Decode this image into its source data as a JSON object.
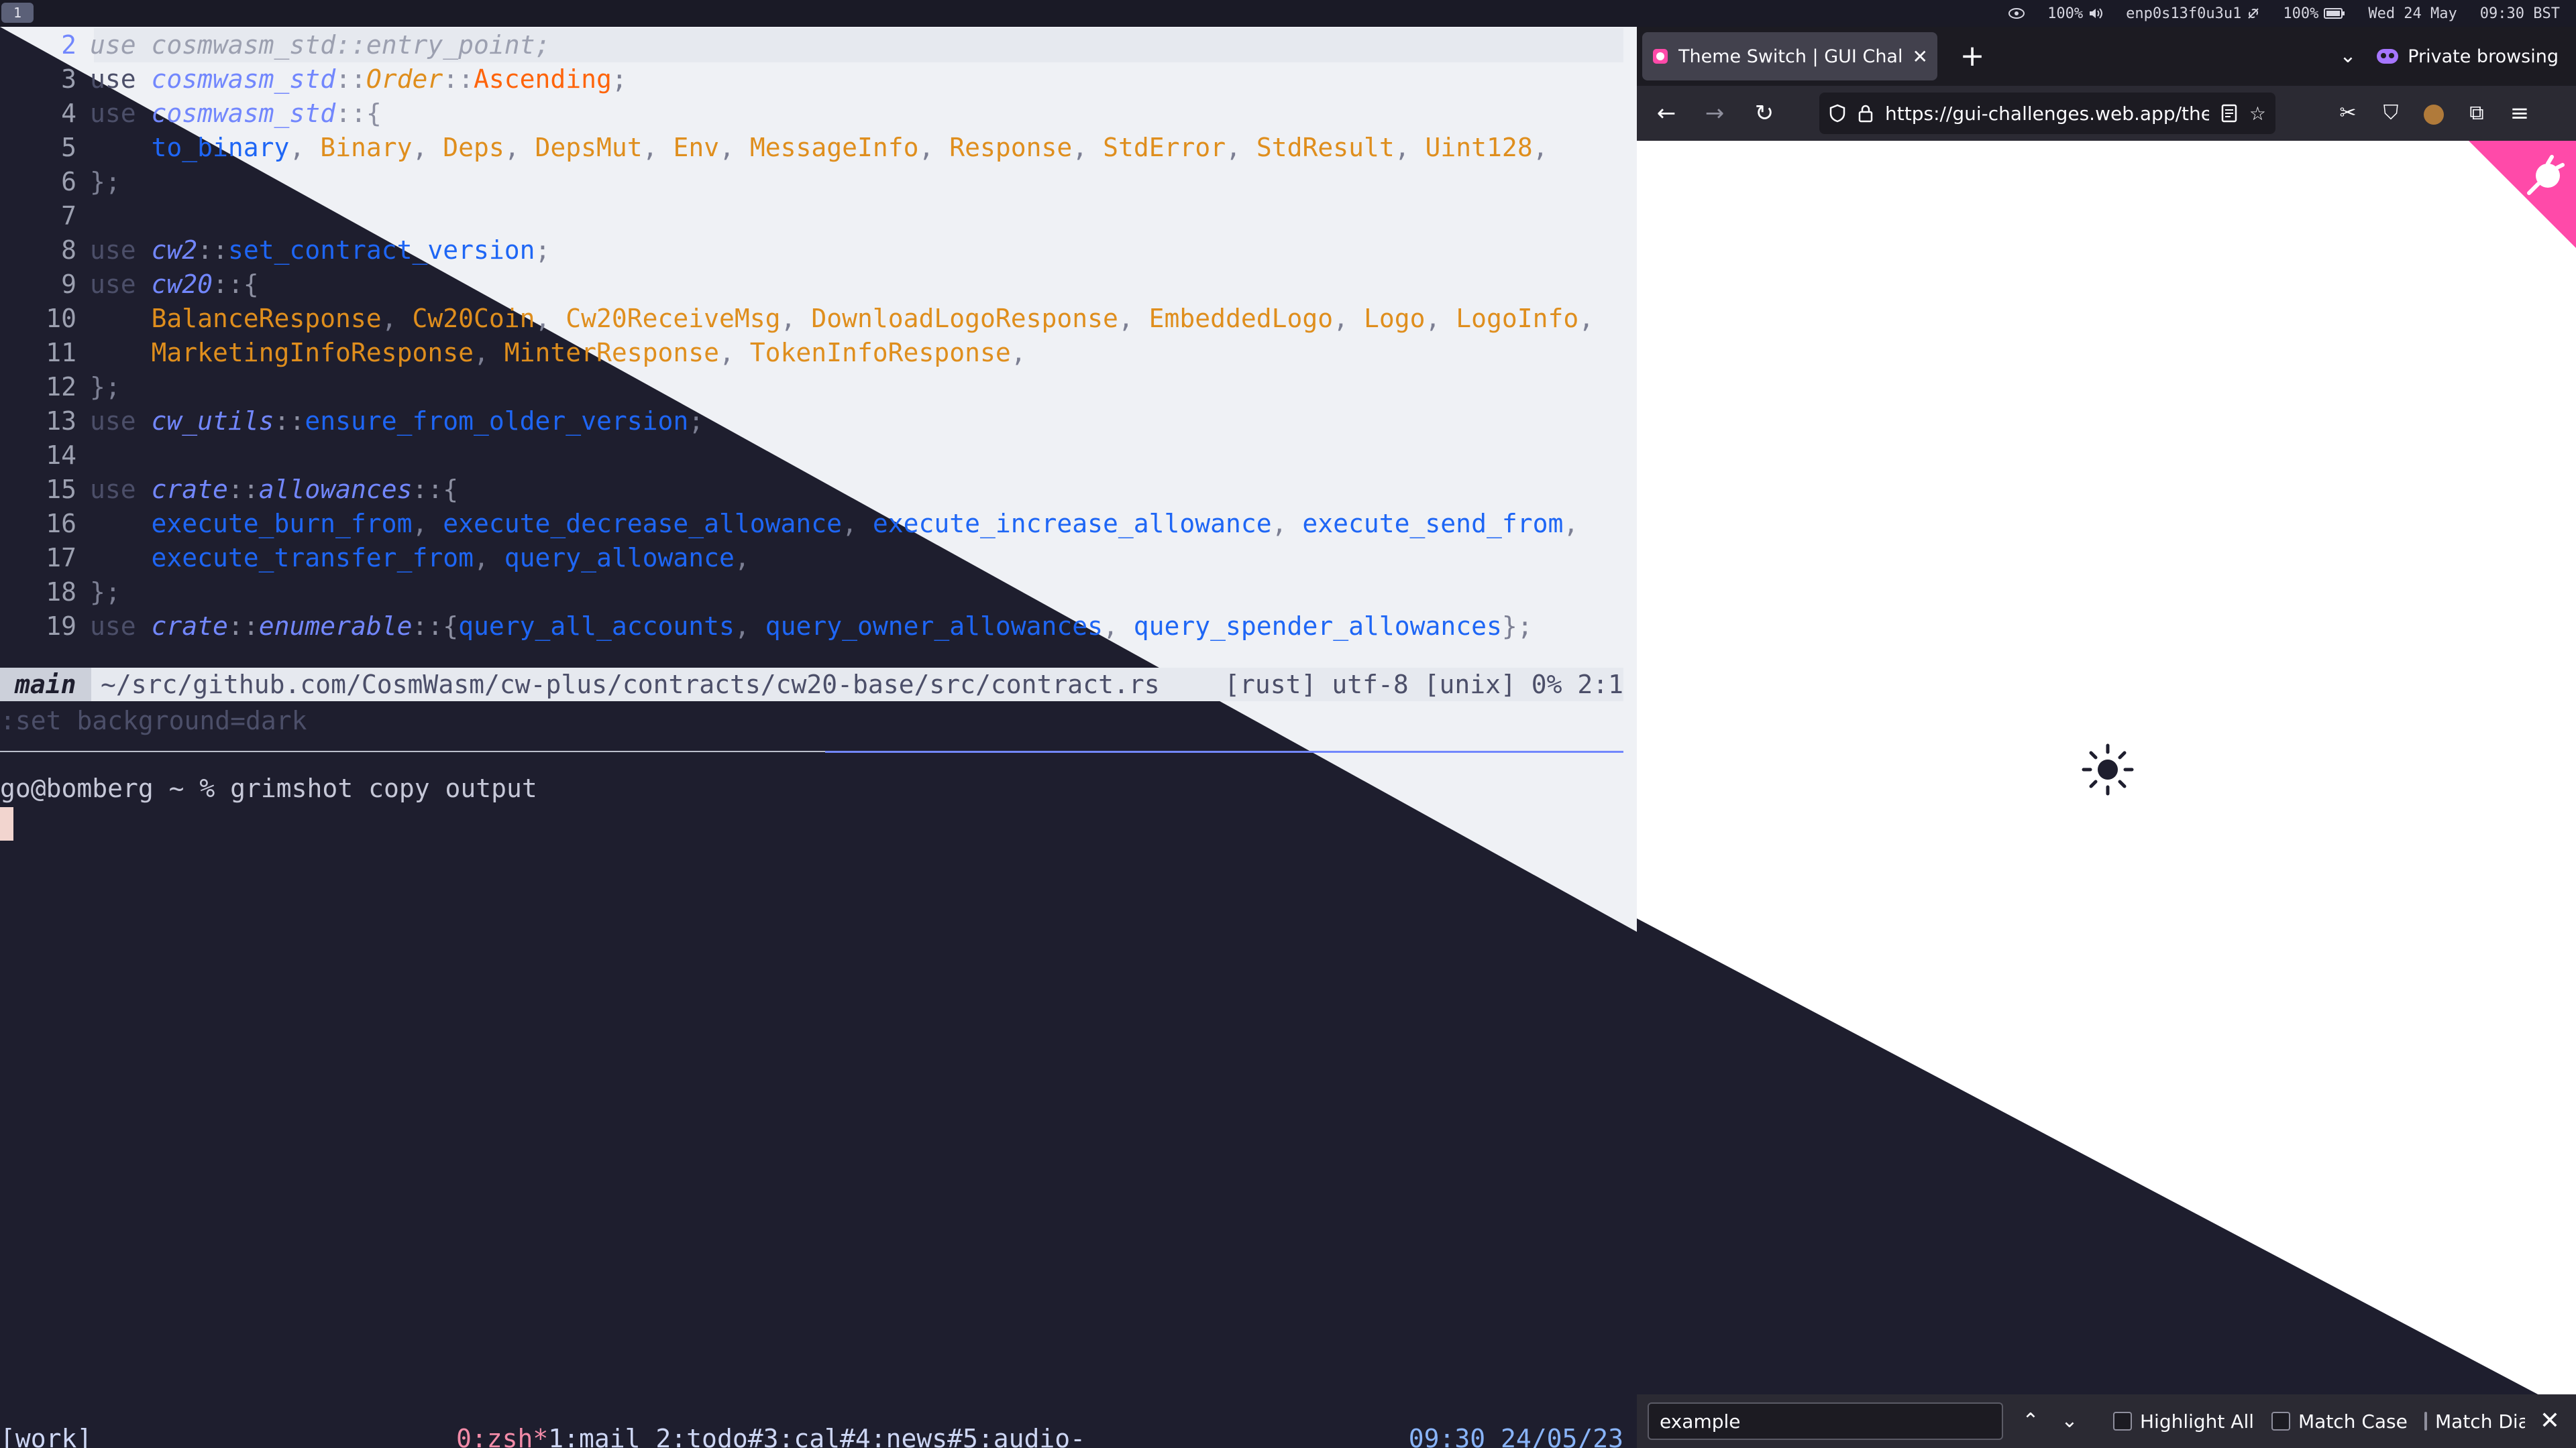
{
  "topbar": {
    "workspace": "1",
    "tray": [
      {
        "icon": "eye-icon",
        "text": ""
      },
      {
        "icon": "volume-icon",
        "text": "100%"
      },
      {
        "icon": "network-icon",
        "text": "enp0s13f0u3u1"
      },
      {
        "icon": "battery-icon",
        "text": "100%"
      },
      {
        "icon": "",
        "text": "Wed 24 May"
      },
      {
        "icon": "",
        "text": "09:30 BST"
      }
    ]
  },
  "editor": {
    "lines": [
      {
        "n": "2",
        "current": true
      },
      {
        "n": "3"
      },
      {
        "n": "4"
      },
      {
        "n": "5"
      },
      {
        "n": "6"
      },
      {
        "n": "7"
      },
      {
        "n": "8"
      },
      {
        "n": "9"
      },
      {
        "n": "10"
      },
      {
        "n": "11"
      },
      {
        "n": "12"
      },
      {
        "n": "13"
      },
      {
        "n": "14"
      },
      {
        "n": "15"
      },
      {
        "n": "16"
      },
      {
        "n": "17"
      },
      {
        "n": "18"
      },
      {
        "n": "19"
      }
    ],
    "tokens": {
      "use": "use",
      "cosmwasm_std": "cosmwasm_std",
      "entry_point": "entry_point",
      "Order": "Order",
      "Ascending": "Ascending",
      "l5": [
        "to_binary",
        "Binary",
        "Deps",
        "DepsMut",
        "Env",
        "MessageInfo",
        "Response",
        "StdError",
        "StdResult",
        "Uint128"
      ],
      "cw2": "cw2",
      "set_contract_version": "set_contract_version",
      "cw20": "cw20",
      "l10": [
        "BalanceResponse",
        "Cw20Coin",
        "Cw20ReceiveMsg",
        "DownloadLogoResponse",
        "EmbeddedLogo",
        "Logo",
        "LogoInfo"
      ],
      "l11": [
        "MarketingInfoResponse",
        "MinterResponse",
        "TokenInfoResponse"
      ],
      "cw_utils": "cw_utils",
      "ensure_from_older_version": "ensure_from_older_version",
      "crate": "crate",
      "allowances": "allowances",
      "l16": [
        "execute_burn_from",
        "execute_decrease_allowance",
        "execute_increase_allowance",
        "execute_send_from"
      ],
      "l17": [
        "execute_transfer_from",
        "query_allowance"
      ],
      "enumerable": "enumerable",
      "l19": [
        "query_all_accounts",
        "query_owner_allowances",
        "query_spender_allowances"
      ]
    },
    "status": {
      "mode": "main",
      "file": "~/src/github.com/CosmWasm/cw-plus/contracts/cw20-base/src/contract.rs",
      "info": "[rust] utf-8 [unix] 0% 2:1"
    },
    "cmdline": ":set background=dark"
  },
  "shell": {
    "prompt": "go@bomberg ~ % grimshot copy output"
  },
  "tmux": {
    "session": "[work]",
    "windows_active": "0:zsh*",
    "windows_rest": "1:mail 2:todo#3:cal#4:news#5:audio-",
    "time": "09:30 24/05/23"
  },
  "browser": {
    "tab_title": "Theme Switch | GUI Challenges",
    "private_label": "Private browsing",
    "url": "https://gui-challenges.web.app/theme-switch/dist/",
    "find": {
      "value": "example",
      "highlight_all": "Highlight All",
      "match_case": "Match Case",
      "match_diacritics": "Match Diacritics"
    }
  },
  "colors": {
    "terminal_dark": "#1e1e2e",
    "editor_light": "#eff1f5",
    "browser_accent": "#ff4aa9",
    "tmux_active": "#f38ba8"
  }
}
